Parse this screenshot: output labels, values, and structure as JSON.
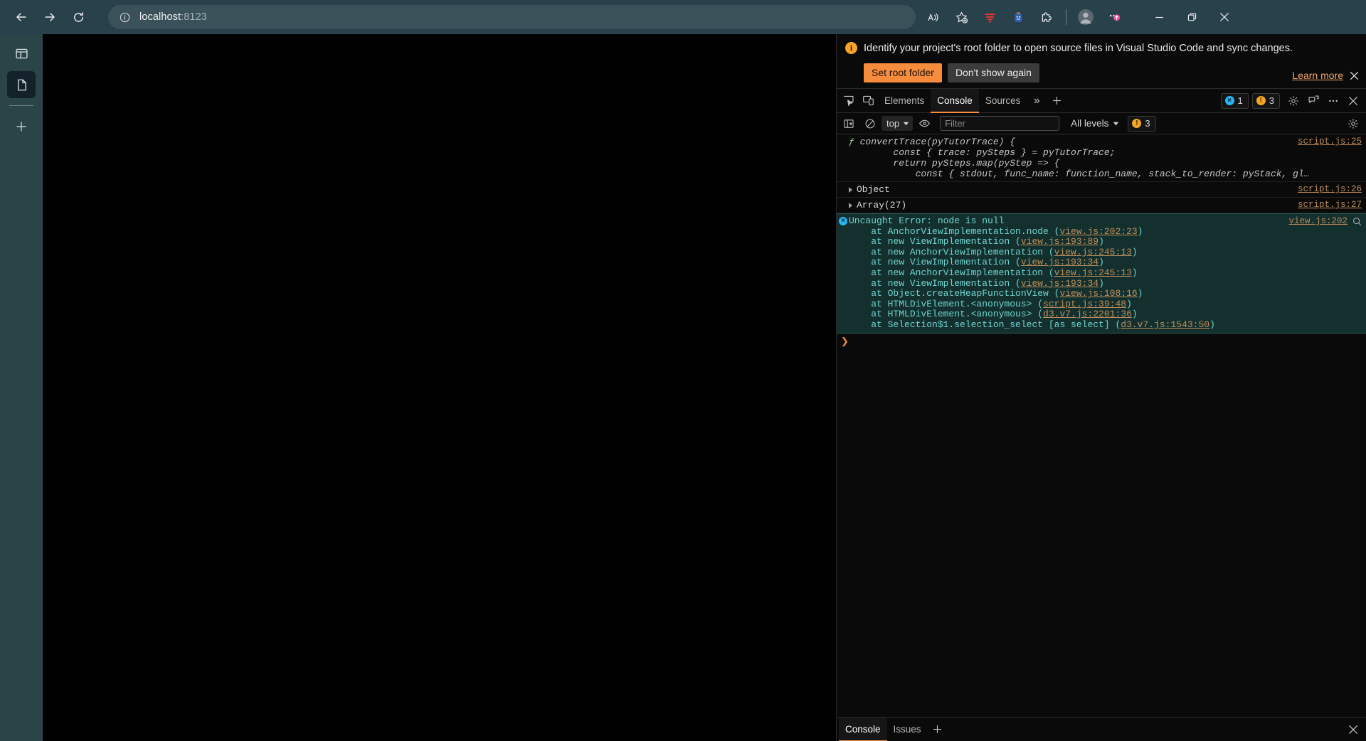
{
  "browser": {
    "back_label": "Back",
    "forward_label": "Forward",
    "refresh_label": "Refresh",
    "address": "localhost:8123",
    "address_host": "localhost",
    "address_port": ":8123",
    "icons": {
      "site_info": "info-icon",
      "read_aloud": "read-aloud-icon",
      "favorites": "add-favorite-icon",
      "extension_filter": "filter-extension-icon",
      "extension_blue": "blue-extension-icon",
      "extensions_puzzle": "extensions-puzzle-icon",
      "profile": "profile-avatar-icon",
      "settings_more": "settings-and-more-icon"
    },
    "window": {
      "minimize": "minimize-icon",
      "restore": "restore-icon",
      "close": "close-icon"
    }
  },
  "sidebar": {
    "items": [
      {
        "name": "tab-actions",
        "icon": "split-pane-icon"
      },
      {
        "name": "current-tab",
        "icon": "page-icon",
        "active": true
      },
      {
        "name": "new-tab",
        "icon": "plus-icon"
      }
    ]
  },
  "devtools": {
    "banner": {
      "message": "Identify your project's root folder to open source files in Visual Studio Code and sync changes.",
      "primary_button": "Set root folder",
      "secondary_button": "Don't show again",
      "learn_more": "Learn more",
      "close": "close-icon",
      "info_glyph": "i"
    },
    "tabs": [
      {
        "label": "Elements",
        "active": false
      },
      {
        "label": "Console",
        "active": true
      },
      {
        "label": "Sources",
        "active": false
      }
    ],
    "tab_overflow": "»",
    "tab_add": "+",
    "badges": {
      "errors": {
        "count": "1",
        "glyph": "×"
      },
      "warnings": {
        "count": "3",
        "glyph": "!"
      }
    },
    "toolbar_icons": {
      "inspect": "inspect-element-icon",
      "device": "device-toolbar-icon",
      "settings": "gear-icon",
      "customize": "more-options-icon",
      "close": "close-devtools-icon",
      "feedback": "feedback-icon"
    },
    "filterbar": {
      "sidebar_toggle": "console-sidebar-icon",
      "clear": "clear-console-icon",
      "context": "top",
      "eye": "live-expression-icon",
      "filter_placeholder": "Filter",
      "filter_value": "",
      "levels_label": "All levels",
      "warn_count": "3",
      "settings": "gear-icon"
    },
    "console": {
      "messages": [
        {
          "type": "function-snippet",
          "kw": "ƒ",
          "lines": [
            "convertTrace(pyTutorTrace) {",
            "        const { trace: pySteps } = pyTutorTrace;",
            "        return pySteps.map(pyStep => {",
            "            const { stdout, func_name: function_name, stack_to_render: pyStack, gl…"
          ],
          "source": "script.js:25"
        },
        {
          "type": "object",
          "label": "Object",
          "source": "script.js:26"
        },
        {
          "type": "object",
          "label": "Array(27)",
          "source": "script.js:27"
        },
        {
          "type": "error",
          "title": "Uncaught Error: node is null",
          "source": "view.js:202",
          "stack": [
            {
              "prefix": "    at AnchorViewImplementation.node (",
              "link": "view.js:202:23",
              "suffix": ")"
            },
            {
              "prefix": "    at new ViewImplementation (",
              "link": "view.js:193:89",
              "suffix": ")"
            },
            {
              "prefix": "    at new AnchorViewImplementation (",
              "link": "view.js:245:13",
              "suffix": ")"
            },
            {
              "prefix": "    at new ViewImplementation (",
              "link": "view.js:193:34",
              "suffix": ")"
            },
            {
              "prefix": "    at new AnchorViewImplementation (",
              "link": "view.js:245:13",
              "suffix": ")"
            },
            {
              "prefix": "    at new ViewImplementation (",
              "link": "view.js:193:34",
              "suffix": ")"
            },
            {
              "prefix": "    at Object.createHeapFunctionView (",
              "link": "view.js:108:16",
              "suffix": ")"
            },
            {
              "prefix": "    at HTMLDivElement.<anonymous> (",
              "link": "script.js:39:48",
              "suffix": ")"
            },
            {
              "prefix": "    at HTMLDivElement.<anonymous> (",
              "link": "d3.v7.js:2201:36",
              "suffix": ")"
            },
            {
              "prefix": "    at Selection$1.selection_select [as select] (",
              "link": "d3.v7.js:1543:50",
              "suffix": ")"
            }
          ]
        }
      ],
      "prompt_caret": "❯"
    },
    "drawer": {
      "tabs": [
        {
          "label": "Console",
          "active": true
        },
        {
          "label": "Issues",
          "active": false
        }
      ],
      "add": "+",
      "close": "close-icon"
    }
  },
  "colors": {
    "accent_orange": "#f78c3d",
    "browser_chrome": "#29414a",
    "devtools_bg": "#0a0a0a",
    "error_bg": "#14302e",
    "error_text": "#6fd5d0",
    "link": "#ba8a5b"
  }
}
